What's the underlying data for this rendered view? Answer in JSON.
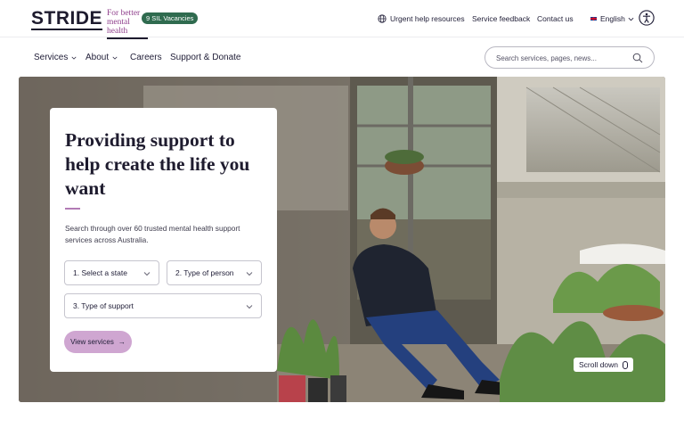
{
  "brand": {
    "logo_word": "STRIDE",
    "logo_tagline_1": "For better",
    "logo_tagline_2": "mental health",
    "accent_color": "#8f3f8c",
    "dark_color": "#1e1b2e"
  },
  "topbar": {
    "vacancies_badge": "9 SIL Vacancies",
    "badge_color": "#2f6b4f",
    "urgent_help": "Urgent help resources",
    "service_feedback": "Service feedback",
    "contact": "Contact us",
    "language": "English",
    "globe_icon": "globe-icon",
    "accessibility_icon": "accessibility-icon"
  },
  "nav": {
    "items": [
      {
        "label": "Services",
        "has_dropdown": true
      },
      {
        "label": "About",
        "has_dropdown": true
      },
      {
        "label": "Careers",
        "has_dropdown": false
      },
      {
        "label": "Support & Donate",
        "has_dropdown": false
      }
    ]
  },
  "search": {
    "placeholder": "Search services, pages, news...",
    "value": "",
    "icon": "search-icon"
  },
  "hero": {
    "title": "Providing support to help create the life you want",
    "description": "Search through over 60 trusted mental health support services across Australia.",
    "select_state": "1. Select a state",
    "select_person": "2. Type of person",
    "select_support": "3. Type of support",
    "view_button": "View services",
    "view_button_color": "#cfa6d1",
    "scroll_label": "Scroll down"
  }
}
